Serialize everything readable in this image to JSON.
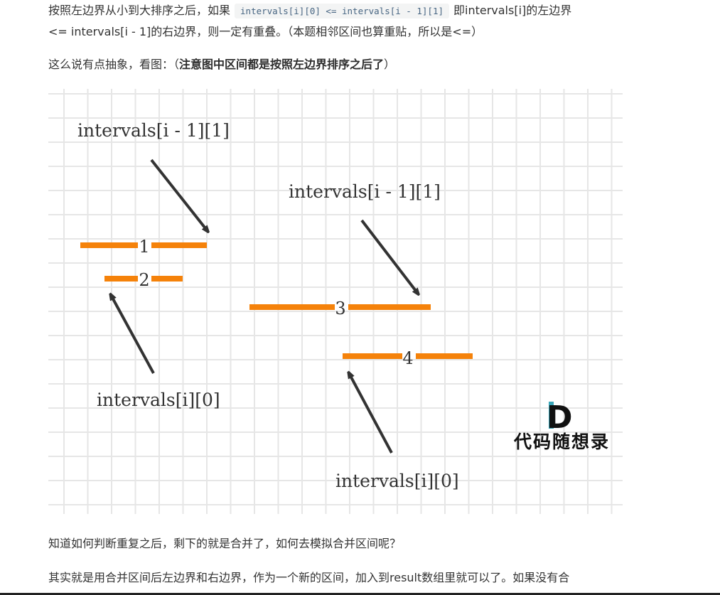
{
  "text": {
    "p1_a": "按照左边界从小到大排序之后，如果",
    "p1_code": "intervals[i][0] <= intervals[i - 1][1]",
    "p1_b": "即intervals[i]的左边界",
    "p2": "<= intervals[i - 1]的右边界，则一定有重叠。（本题相邻区间也算重贴，所以是<=）",
    "p3_a": "这么说有点抽象，看图：（",
    "p3_bold": "注意图中区间都是按照左边界排序之后了",
    "p3_c": "）",
    "p4": "知道如何判断重复之后，剩下的就是合并了，如何去模拟合并区间呢？",
    "p5": "其实就是用合并区间后左边界和右边界，作为一个新的区间，加入到result数组里就可以了。如果没有合"
  },
  "figure": {
    "labels": {
      "top_left": "intervals[i - 1][1]",
      "top_right": "intervals[i - 1][1]",
      "bottom_left": "intervals[i][0]",
      "bottom_right": "intervals[i][0]"
    },
    "interval_numbers": [
      "1",
      "2",
      "3",
      "4"
    ],
    "watermark_letter": "D",
    "watermark_text": "代码随想录",
    "colors": {
      "interval": "#f5820a",
      "arrow": "#333333",
      "grid": "#e6e6e6",
      "watermark_accent": "#3aa6b9"
    }
  }
}
